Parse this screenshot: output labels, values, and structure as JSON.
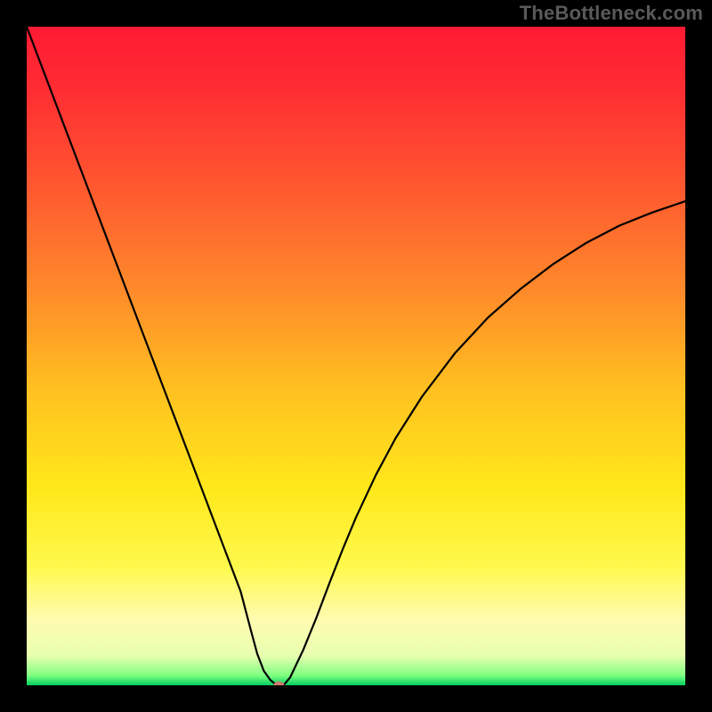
{
  "watermark": "TheBottleneck.com",
  "chart_data": {
    "type": "line",
    "title": "",
    "xlabel": "",
    "ylabel": "",
    "xlim": [
      0,
      100
    ],
    "ylim": [
      0,
      100
    ],
    "background_gradient": {
      "stops": [
        {
          "pos": 0.0,
          "color": "#ff1a33"
        },
        {
          "pos": 0.1,
          "color": "#ff2e33"
        },
        {
          "pos": 0.25,
          "color": "#ff5a2f"
        },
        {
          "pos": 0.4,
          "color": "#ff8a2a"
        },
        {
          "pos": 0.55,
          "color": "#ffc020"
        },
        {
          "pos": 0.7,
          "color": "#ffe81a"
        },
        {
          "pos": 0.82,
          "color": "#fff94d"
        },
        {
          "pos": 0.9,
          "color": "#fffbb0"
        },
        {
          "pos": 0.955,
          "color": "#e8ffb0"
        },
        {
          "pos": 0.985,
          "color": "#80ff80"
        },
        {
          "pos": 1.0,
          "color": "#00d060"
        }
      ]
    },
    "series": [
      {
        "name": "bottleneck-curve",
        "color": "#000000",
        "width": 2.2,
        "x": [
          0,
          2.5,
          5,
          7.5,
          10,
          12.5,
          15,
          17.5,
          20,
          22.5,
          25,
          27.5,
          30,
          32.5,
          34,
          35,
          36,
          37,
          38,
          39,
          40,
          42,
          44,
          46,
          48,
          50,
          53,
          56,
          60,
          65,
          70,
          75,
          80,
          85,
          90,
          95,
          100
        ],
        "y": [
          100,
          93.4,
          86.8,
          80.2,
          73.6,
          67.0,
          60.4,
          53.8,
          47.2,
          40.6,
          34.0,
          27.4,
          20.8,
          14.2,
          8.5,
          4.8,
          2.2,
          0.8,
          0.0,
          0.0,
          1.2,
          5.4,
          10.3,
          15.6,
          20.7,
          25.5,
          31.9,
          37.5,
          43.8,
          50.4,
          55.8,
          60.2,
          64.0,
          67.2,
          69.8,
          71.8,
          73.5
        ]
      }
    ],
    "marker": {
      "name": "optimal-point",
      "x": 38.3,
      "y": 0.0,
      "rx": 6,
      "ry": 4.5,
      "fill": "#cf7a6c"
    }
  }
}
